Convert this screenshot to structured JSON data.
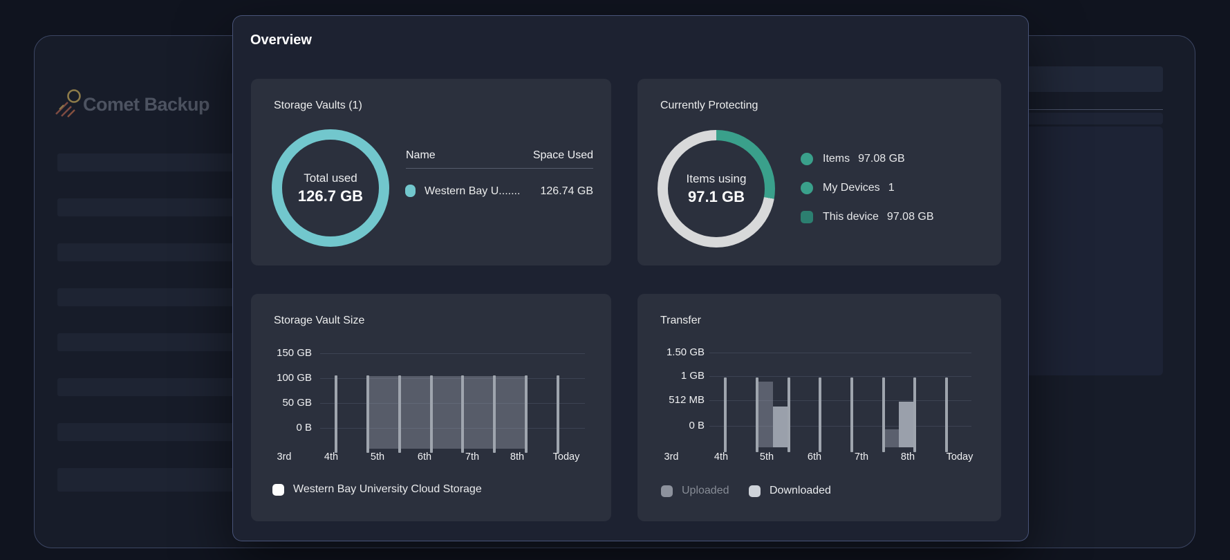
{
  "background_window": {
    "logo_text": "Comet Backup"
  },
  "modal": {
    "title": "Overview",
    "cards": {
      "storage_vaults": {
        "title": "Storage Vaults (1)",
        "donut_center_label": "Total used",
        "donut_center_value": "126.7 GB",
        "table": {
          "col_name": "Name",
          "col_space": "Space Used",
          "rows": [
            {
              "name": "Western Bay U.......",
              "space_used": "126.74 GB"
            }
          ]
        },
        "accent_color": "#72c7cd"
      },
      "currently_protecting": {
        "title": "Currently Protecting",
        "donut_center_label": "Items using",
        "donut_center_value": "97.1 GB",
        "legend": [
          {
            "label": "Items",
            "value": "97.08 GB"
          },
          {
            "label": "My Devices",
            "value": "1"
          },
          {
            "label": "This device",
            "value": "97.08 GB"
          }
        ],
        "accent_color": "#3aa08b",
        "ring_rest_color": "#d8d9da"
      },
      "storage_vault_size": {
        "title": "Storage Vault Size",
        "legend": [
          {
            "label": "Western Bay University Cloud Storage",
            "marker_color": "#fdfdfd"
          }
        ]
      },
      "transfer": {
        "title": "Transfer",
        "legend": [
          {
            "label": "Uploaded",
            "marker_color": "#8d929d",
            "text_color": "#878c96"
          },
          {
            "label": "Downloaded",
            "marker_color": "#ced2d9",
            "text_color": "#e9ebee"
          }
        ]
      }
    }
  },
  "chart_data": [
    {
      "type": "pie",
      "subtype": "donut",
      "title": "Storage Vaults (1)",
      "center_label": "Total used",
      "center_value": "126.7 GB",
      "segments": [
        {
          "label": "Western Bay U.......",
          "value": "126.74 GB",
          "fraction": 1.0,
          "color": "#72c7cd"
        }
      ]
    },
    {
      "type": "pie",
      "subtype": "donut",
      "title": "Currently Protecting",
      "center_label": "Items using",
      "center_value": "97.1 GB",
      "segments": [
        {
          "label": "Items",
          "value": "97.08 GB",
          "arc_deg": 100,
          "color": "#3aa08b"
        },
        {
          "label": "unfilled",
          "value": "",
          "arc_deg": 260,
          "color": "#d8d9da"
        }
      ],
      "legend_rows": [
        {
          "label": "Items",
          "value": "97.08 GB"
        },
        {
          "label": "My Devices",
          "value": "1"
        },
        {
          "label": "This device",
          "value": "97.08 GB"
        }
      ]
    },
    {
      "type": "area",
      "title": "Storage Vault Size",
      "categories": [
        "3rd",
        "4th",
        "5th",
        "6th",
        "7th",
        "8th",
        "Today"
      ],
      "series": [
        {
          "name": "Western Bay University Cloud Storage",
          "values_gb": [
            0,
            0,
            97,
            97,
            97,
            97,
            0
          ]
        }
      ],
      "ylabels": [
        "150 GB",
        "100 GB",
        "50 GB",
        "0 B"
      ],
      "ylim_gb": [
        0,
        150
      ],
      "grid": "horizontal",
      "legend_position": "bottom-left"
    },
    {
      "type": "bar",
      "title": "Transfer",
      "categories": [
        "3rd",
        "4th",
        "5th",
        "6th",
        "7th",
        "8th",
        "Today"
      ],
      "series": [
        {
          "name": "Uploaded",
          "color": "#8d929d",
          "values_gb": [
            0,
            0,
            0.93,
            0,
            0,
            0.08,
            0
          ]
        },
        {
          "name": "Downloaded",
          "color": "#ced2d9",
          "values_gb": [
            0,
            0,
            0.42,
            0,
            0,
            0.52,
            0
          ]
        }
      ],
      "ylabels": [
        "1.50 GB",
        "1 GB",
        "512 MB",
        "0 B"
      ],
      "ylim_gb": [
        0,
        1.5
      ],
      "grid": "horizontal",
      "legend_position": "bottom-left"
    }
  ]
}
